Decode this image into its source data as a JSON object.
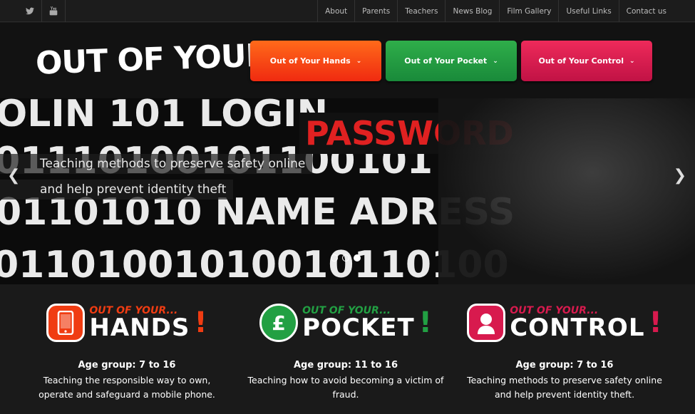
{
  "colors": {
    "hands": "#f03c12",
    "pocket": "#22a043",
    "control": "#d81a4e",
    "home": "#f36c1f"
  },
  "social": [
    {
      "icon": "twitter-icon"
    },
    {
      "icon": "youtube-icon"
    }
  ],
  "topnav": [
    "About",
    "Parents",
    "Teachers",
    "News Blog",
    "Film Gallery",
    "Useful Links",
    "Contact us"
  ],
  "logo": {
    "text": "OUT OF YOUR",
    "dot": "."
  },
  "mainnav": {
    "hands": "Out of Your Hands",
    "pocket": "Out of Your Pocket",
    "control": "Out of Your Control"
  },
  "slider": {
    "bg_rows": [
      "OLIN 101 LOGIN",
      "01110100101100101",
      "01101010 NAME ADRESS",
      "01101001010010110100"
    ],
    "highlight": "PASSWORD",
    "caption_line1": "Teaching methods to preserve safety online",
    "caption_line2": "and help prevent identity theft",
    "slides": 3,
    "active_slide": 3
  },
  "features": [
    {
      "badge_small": "OUT OF YOUR...",
      "badge_big": "HANDS",
      "excl": "!",
      "age": "Age group: 7 to 16",
      "desc": "Teaching the responsible way to own, operate and safeguard a mobile phone."
    },
    {
      "badge_small": "OUT OF YOUR...",
      "badge_big": "POCKET",
      "excl": "!",
      "age": "Age group: 11 to 16",
      "desc": "Teaching how to avoid becoming a victim of fraud."
    },
    {
      "badge_small": "OUT OF YOUR...",
      "badge_big": "CONTROL",
      "excl": "!",
      "age": "Age group: 7 to 16",
      "desc": "Teaching methods to preserve safety online and help prevent identity theft."
    }
  ]
}
